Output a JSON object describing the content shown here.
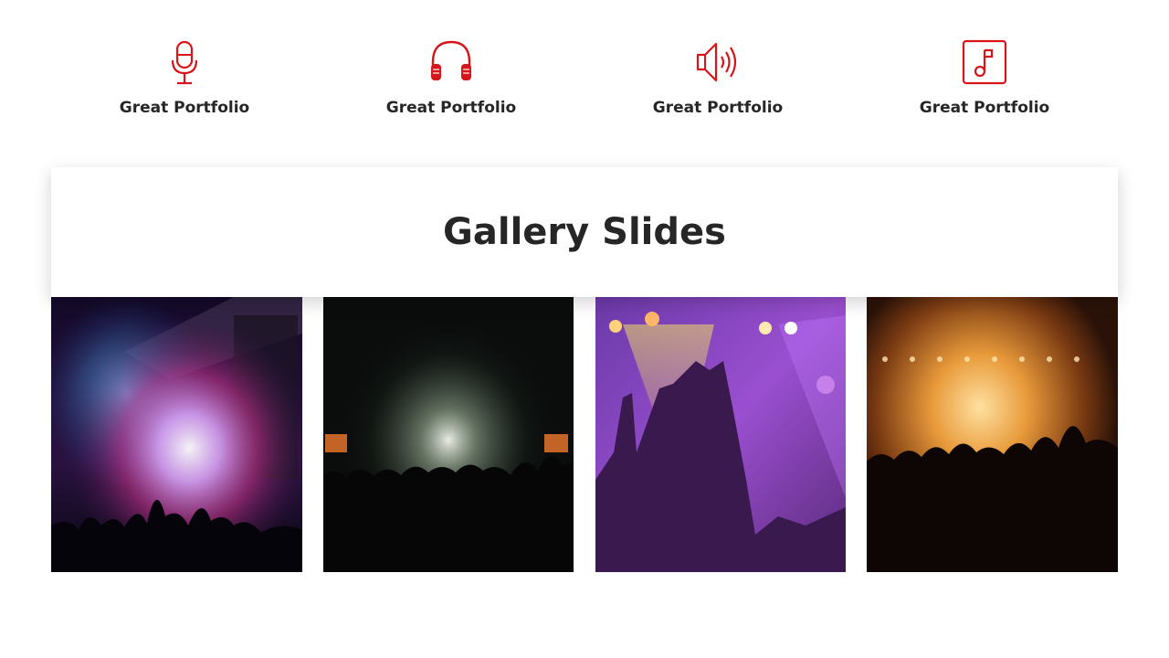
{
  "features": [
    {
      "label": "Great Portfolio",
      "icon": "microphone-icon"
    },
    {
      "label": "Great Portfolio",
      "icon": "headphones-icon"
    },
    {
      "label": "Great Portfolio",
      "icon": "speaker-icon"
    },
    {
      "label": "Great Portfolio",
      "icon": "music-note-icon"
    }
  ],
  "banner": {
    "title": "Gallery Slides"
  },
  "gallery": [
    {
      "name": "concert-fireworks-photo"
    },
    {
      "name": "concert-confetti-photo"
    },
    {
      "name": "concert-hands-purple-photo"
    },
    {
      "name": "concert-crowd-orange-photo"
    }
  ],
  "colors": {
    "accent": "#d7141a",
    "text": "#262626"
  }
}
